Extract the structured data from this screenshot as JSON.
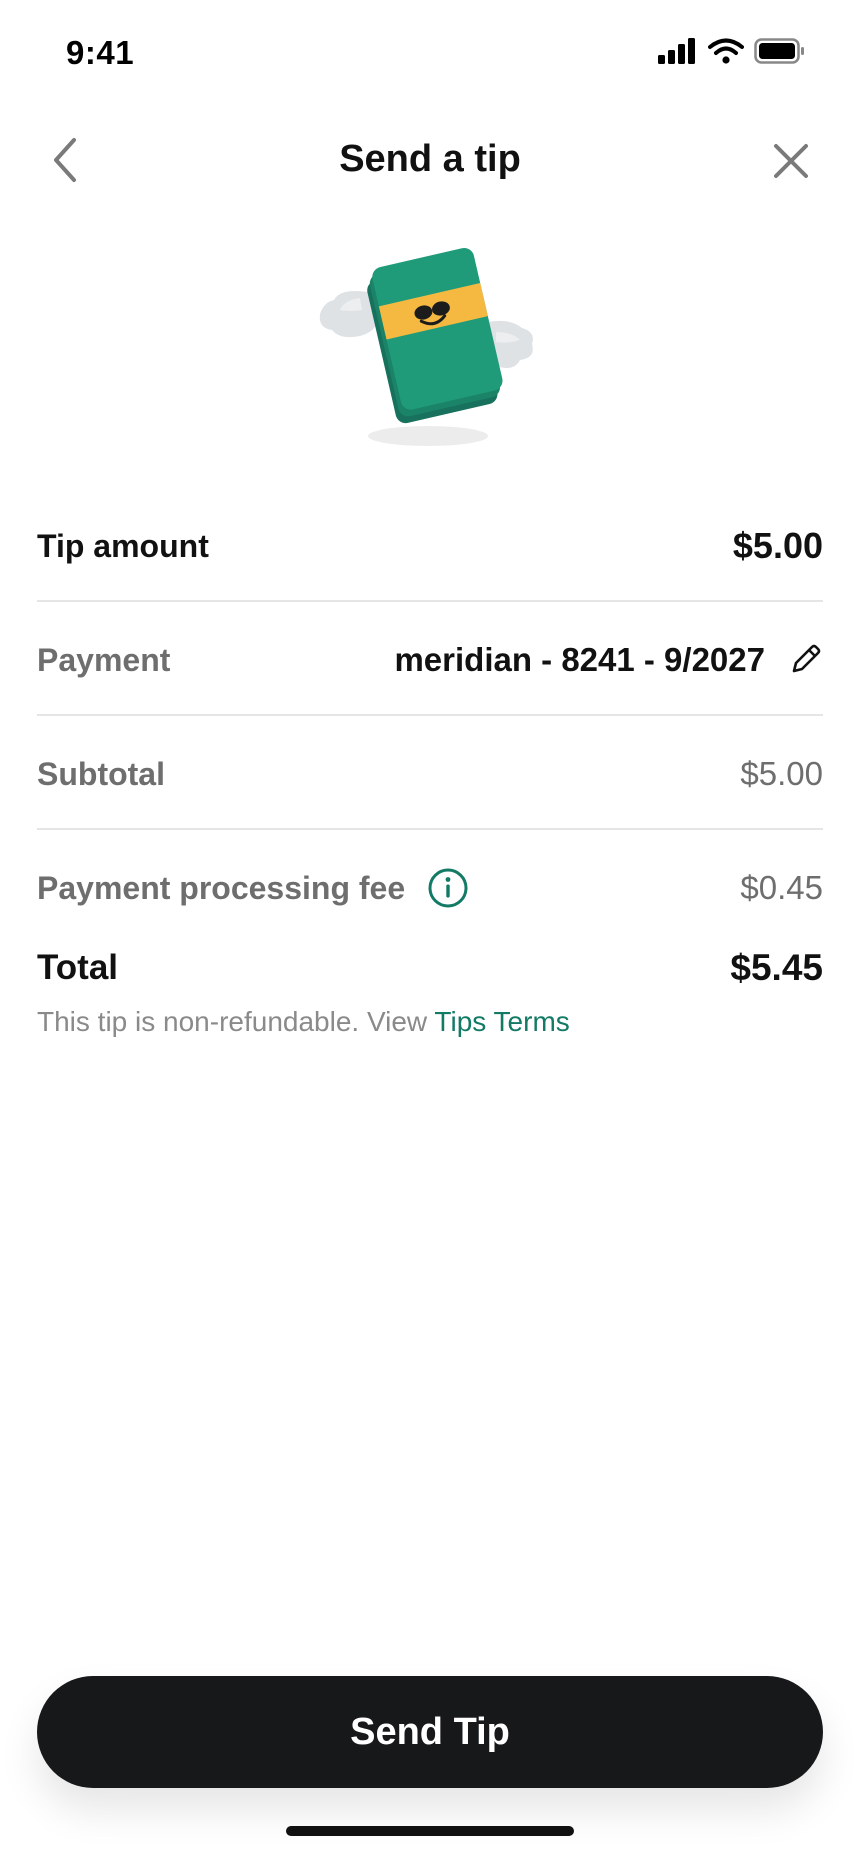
{
  "status_bar": {
    "time": "9:41",
    "icons": [
      "signal-icon",
      "wifi-icon",
      "battery-icon"
    ]
  },
  "nav": {
    "title": "Send a tip",
    "back_icon": "chevron-left-icon",
    "close_icon": "close-icon"
  },
  "hero": {
    "icon": "smiling-cash-stack-illustration"
  },
  "rows": {
    "tip_amount": {
      "label": "Tip amount",
      "value": "$5.00"
    },
    "payment": {
      "label": "Payment",
      "value": "meridian - 8241 - 9/2027",
      "edit_icon": "pencil-icon"
    },
    "subtotal": {
      "label": "Subtotal",
      "value": "$5.00"
    },
    "fee": {
      "label": "Payment processing fee",
      "value": "$0.45",
      "info_icon": "info-icon"
    },
    "total": {
      "label": "Total",
      "value": "$5.45"
    }
  },
  "disclaimer": {
    "text": "This tip is non-refundable. View ",
    "link": "Tips Terms"
  },
  "send_button": {
    "label": "Send Tip"
  },
  "colors": {
    "accent": "#127a65",
    "button_bg": "#17181a",
    "cash_green": "#1f9b7a",
    "band_yellow": "#f5b942"
  }
}
